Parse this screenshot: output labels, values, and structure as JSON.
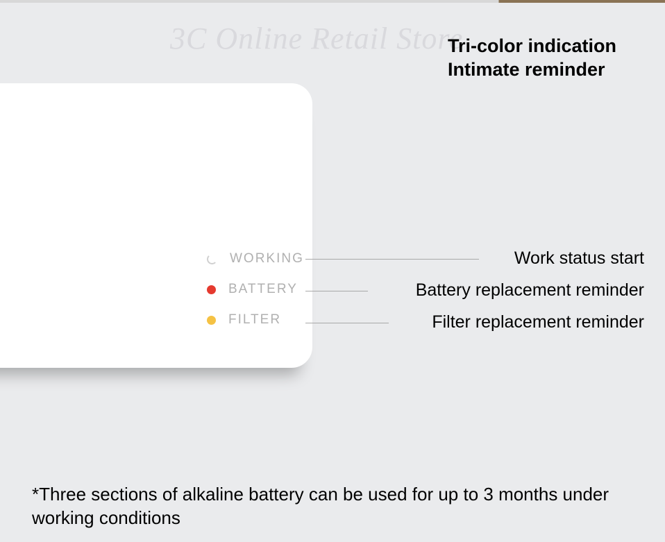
{
  "watermark": "3C Online Retail Store",
  "heading_line1": "Tri-color indication",
  "heading_line2": "Intimate reminder",
  "indicators": {
    "working": {
      "label": "WORKING",
      "dot_color": "transparent"
    },
    "battery": {
      "label": "BATTERY",
      "dot_color": "#e53a2f"
    },
    "filter": {
      "label": "FILTER",
      "dot_color": "#f5c244"
    }
  },
  "callouts": {
    "working": "Work status start",
    "battery": "Battery replacement reminder",
    "filter": "Filter replacement reminder"
  },
  "footnote": "*Three sections of alkaline battery can be used for up to 3 months under working conditions"
}
